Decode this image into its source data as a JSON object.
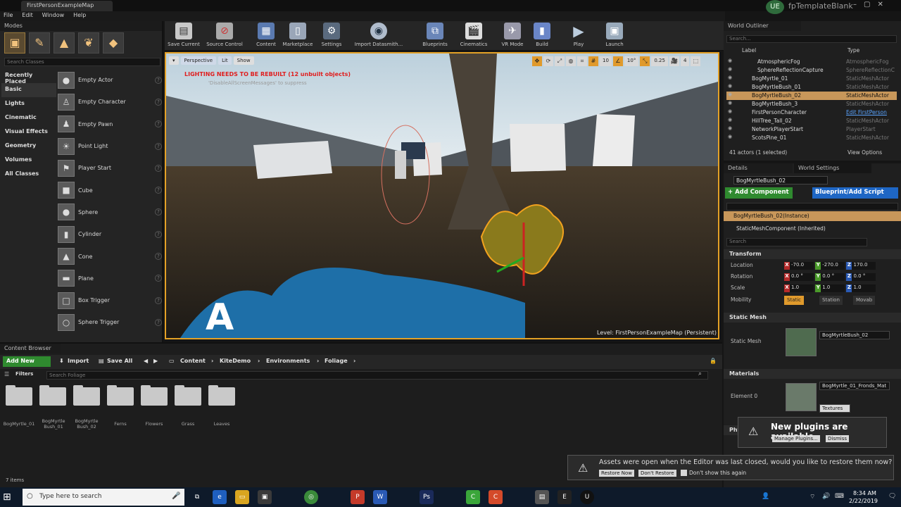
{
  "titlebar": {
    "tab": "FirstPersonExampleMap",
    "project": "fpTemplateBlank",
    "logo": "UE",
    "window_buttons": "–▢✕"
  },
  "menu": [
    "File",
    "Edit",
    "Window",
    "Help"
  ],
  "modes": {
    "tab": "Modes",
    "search_placeholder": "Search Classes",
    "mode_icons": [
      "place-icon",
      "paint-icon",
      "landscape-icon",
      "foliage-icon",
      "geometry-icon"
    ],
    "categories": [
      "Recently Placed",
      "Basic",
      "Lights",
      "Cinematic",
      "Visual Effects",
      "Geometry",
      "Volumes",
      "All Classes"
    ],
    "active_category": "Basic",
    "items": [
      "Empty Actor",
      "Empty Character",
      "Empty Pawn",
      "Point Light",
      "Player Start",
      "Cube",
      "Sphere",
      "Cylinder",
      "Cone",
      "Plane",
      "Box Trigger",
      "Sphere Trigger"
    ]
  },
  "toolbar": {
    "buttons": [
      "Save Current",
      "Source Control",
      "Content",
      "Marketplace",
      "Settings",
      "Import Datasmith...",
      "Blueprints",
      "Cinematics",
      "VR Mode",
      "Build",
      "Play",
      "Launch"
    ]
  },
  "viewport": {
    "perspective": "Perspective",
    "lit": "Lit",
    "show": "Show",
    "warning": "LIGHTING NEEDS TO BE REBUILT (12 unbuilt objects)",
    "suppress": "'DisableAllScreenMessages' to suppress",
    "grid_snap": "10",
    "rotation_snap": "10°",
    "scale_snap": "0.25",
    "camera_speed": "4",
    "level_label": "Level:  FirstPersonExampleMap (Persistent)"
  },
  "content_browser": {
    "tab": "Content Browser",
    "add_new": "Add New",
    "import": "Import",
    "save_all": "Save All",
    "breadcrumbs": [
      "Content",
      "KiteDemo",
      "Environments",
      "Foliage"
    ],
    "filters": "Filters",
    "search_placeholder": "Search Foliage",
    "folders": [
      "BogMyrtle_01",
      "BogMyrtle\nBush_01",
      "BogMyrtle\nBush_02",
      "Ferns",
      "Flowers",
      "Grass",
      "Leaves"
    ],
    "item_count": "7 items"
  },
  "outliner": {
    "tab": "World Outliner",
    "search_placeholder": "Search...",
    "col_label": "Label",
    "col_type": "Type",
    "rows": [
      {
        "label": "AtmosphericFog",
        "type": "AtmosphericFog"
      },
      {
        "label": "SphereReflectionCapture",
        "type": "SphereReflectionC"
      },
      {
        "label": "BogMyrtle_01",
        "type": "StaticMeshActor"
      },
      {
        "label": "BogMyrtleBush_01",
        "type": "StaticMeshActor"
      },
      {
        "label": "BogMyrtleBush_02",
        "type": "StaticMeshActor"
      },
      {
        "label": "BogMyrtleBush_3",
        "type": "StaticMeshActor"
      },
      {
        "label": "FirstPersonCharacter",
        "type": "Edit FirstPerson"
      },
      {
        "label": "HillTree_Tall_02",
        "type": "StaticMeshActor"
      },
      {
        "label": "NetworkPlayerStart",
        "type": "PlayerStart"
      },
      {
        "label": "ScotsPine_01",
        "type": "StaticMeshActor"
      }
    ],
    "selected_index": 4,
    "actors_count": "41 actors (1 selected)",
    "view_options": "View Options"
  },
  "details": {
    "tab": "Details",
    "world_settings_tab": "World Settings",
    "actor_name": "BogMyrtleBush_02",
    "add_component": "+ Add Component",
    "blueprint": "Blueprint/Add Script",
    "search_placeholder": "Search",
    "component_instance": "BogMyrtleBush_02(Instance)",
    "component_static": "StaticMeshComponent (Inherited)",
    "transform_header": "Transform",
    "location_label": "Location",
    "rotation_label": "Rotation",
    "scale_label": "Scale",
    "mobility_label": "Mobility",
    "location": [
      "-70.0",
      "-270.0",
      "170.0"
    ],
    "rotation": [
      "0.0 °",
      "0.0 °",
      "0.0 °"
    ],
    "scale": [
      "1.0",
      "1.0",
      "1.0"
    ],
    "mobility": [
      "Static",
      "Station",
      "Movab"
    ],
    "static_mesh_header": "Static Mesh",
    "static_mesh_label": "Static Mesh",
    "static_mesh_value": "BogMyrtleBush_02",
    "materials_header": "Materials",
    "element0_label": "Element 0",
    "material_value": "BogMyrtle_01_Fronds_Mat",
    "textures": "Textures",
    "physics_header": "Phy"
  },
  "popups": {
    "plugins_title": "New plugins are available",
    "manage_plugins": "Manage Plugins...",
    "dismiss": "Dismiss",
    "restore_msg": "Assets were open when the Editor was last closed, would you like to restore them now?",
    "restore_now": "Restore Now",
    "dont_restore": "Don't Restore",
    "dont_show": "Don't show this again"
  },
  "taskbar": {
    "search_placeholder": "Type here to search",
    "time": "8:34 AM",
    "date": "2/22/2019"
  }
}
